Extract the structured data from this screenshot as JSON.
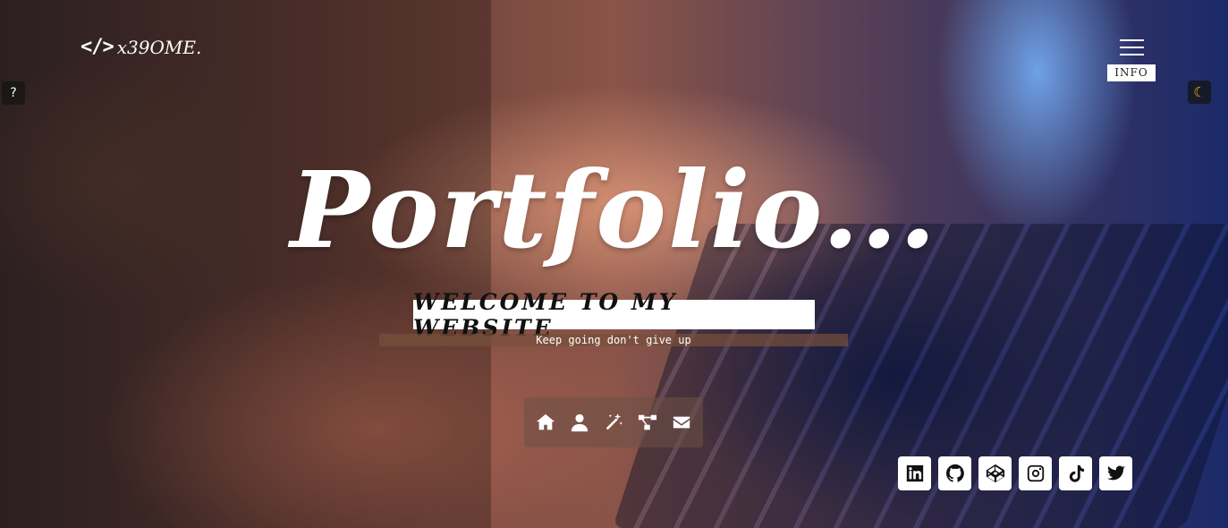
{
  "header": {
    "logo_icon": "</>",
    "logo_text": "x39OME.",
    "menu_label": "INFO"
  },
  "help_button": {
    "label": "?"
  },
  "theme_toggle": {
    "icon": "moon-icon",
    "glyph": "☾",
    "color": "#f2b600"
  },
  "hero": {
    "title": "Portfolio...",
    "welcome": "WELCOME TO MY WEBSITE",
    "tagline": "Keep going don't give up"
  },
  "nav": {
    "items": [
      {
        "icon": "home-icon"
      },
      {
        "icon": "user-icon"
      },
      {
        "icon": "magic-wand-icon"
      },
      {
        "icon": "project-diagram-icon"
      },
      {
        "icon": "envelope-icon"
      }
    ]
  },
  "socials": {
    "items": [
      {
        "icon": "linkedin-icon"
      },
      {
        "icon": "github-icon"
      },
      {
        "icon": "codepen-icon"
      },
      {
        "icon": "instagram-icon"
      },
      {
        "icon": "tiktok-icon"
      },
      {
        "icon": "twitter-icon"
      }
    ]
  }
}
